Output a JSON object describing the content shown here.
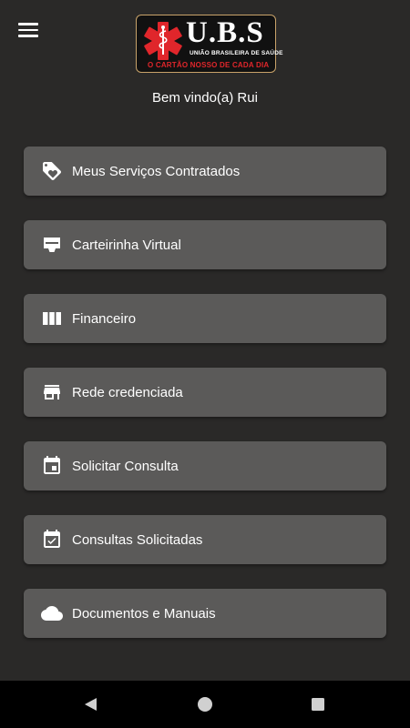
{
  "header": {
    "menu_icon": "hamburger-menu-icon",
    "logo": {
      "brand": "U.B.S",
      "subtitle": "UNIÃO BRASILEIRA DE SAÚDE",
      "tagline": "O CARTÃO NOSSO DE CADA DIA",
      "colors": {
        "star": "#e0262b",
        "border": "#c9a36a",
        "tagline": "#e0262b"
      }
    }
  },
  "welcome": "Bem vindo(a) Rui",
  "menu": [
    {
      "label": "Meus Serviços Contratados",
      "icon": "tag-heart-icon"
    },
    {
      "label": "Carteirinha Virtual",
      "icon": "card-icon"
    },
    {
      "label": "Financeiro",
      "icon": "columns-icon"
    },
    {
      "label": "Rede credenciada",
      "icon": "store-icon"
    },
    {
      "label": "Solicitar Consulta",
      "icon": "calendar-icon"
    },
    {
      "label": "Consultas Solicitadas",
      "icon": "calendar-check-icon"
    },
    {
      "label": "Documentos e Manuais",
      "icon": "cloud-icon"
    }
  ],
  "navbar": {
    "back": "back-icon",
    "home": "home-icon",
    "recents": "recents-icon"
  },
  "colors": {
    "background": "#2a2928",
    "button": "#5b5a59",
    "navbar": "#000000"
  }
}
